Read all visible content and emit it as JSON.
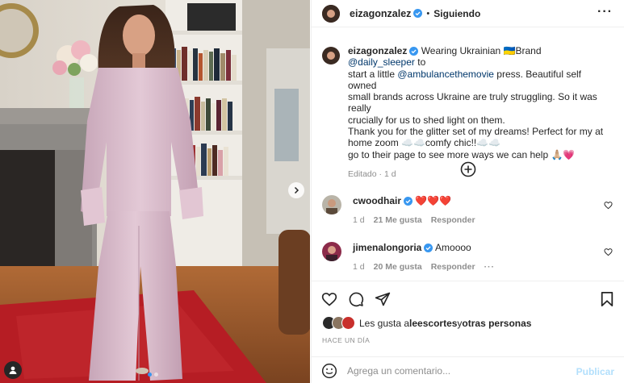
{
  "post": {
    "author": "eizagonzalez",
    "follow_status": "Siguiendo",
    "bullet": "•",
    "more": "···",
    "colors": {
      "accent": "#3897f0",
      "link": "#00376b",
      "muted": "#8e8e8e",
      "heart": "#ed4956"
    }
  },
  "caption": {
    "username": "eizagonzalez",
    "lines": [
      {
        "pre": " Wearing Ukrainian ",
        "flag": "🇺🇦",
        "mid": "Brand ",
        "mention": "@daily_sleeper",
        "post": " to"
      },
      {
        "pre": "start a little ",
        "mention": "@ambulancethemovie",
        "post": " press. Beautiful self owned"
      },
      {
        "text": "small brands across Ukraine are truly struggling. So it was really"
      },
      {
        "text": "crucially for us to shed light on them."
      },
      {
        "text": "Thank you for the glitter set of my dreams! Perfect for my at"
      },
      {
        "text": "home zoom ☁️☁️comfy chic!!☁️☁️"
      },
      {
        "text": "go to their page to see more ways we can help 🙏🏼💗"
      }
    ],
    "edited": "Editado · 1 d"
  },
  "comments": [
    {
      "username": "cwoodhair",
      "text": "❤️❤️❤️",
      "time": "1 d",
      "likes": "21 Me gusta",
      "reply": "Responder",
      "more": ""
    },
    {
      "username": "jimenalongoria",
      "text": "Amoooo",
      "time": "1 d",
      "likes": "20 Me gusta",
      "reply": "Responder",
      "more": "···"
    }
  ],
  "likes_row": {
    "prefix": "Les gusta a ",
    "user": "leescortes",
    "mid": " y ",
    "others": "otras personas"
  },
  "posted_ago": "HACE UN DÍA",
  "add_comment": {
    "placeholder": "Agrega un comentario...",
    "publish": "Publicar"
  },
  "icons": [
    "heart-icon",
    "comment-icon",
    "share-icon",
    "bookmark-icon",
    "add-circle-icon",
    "emoji-icon",
    "chevron-right-icon",
    "user-tag-icon",
    "verified-icon",
    "more-icon"
  ]
}
